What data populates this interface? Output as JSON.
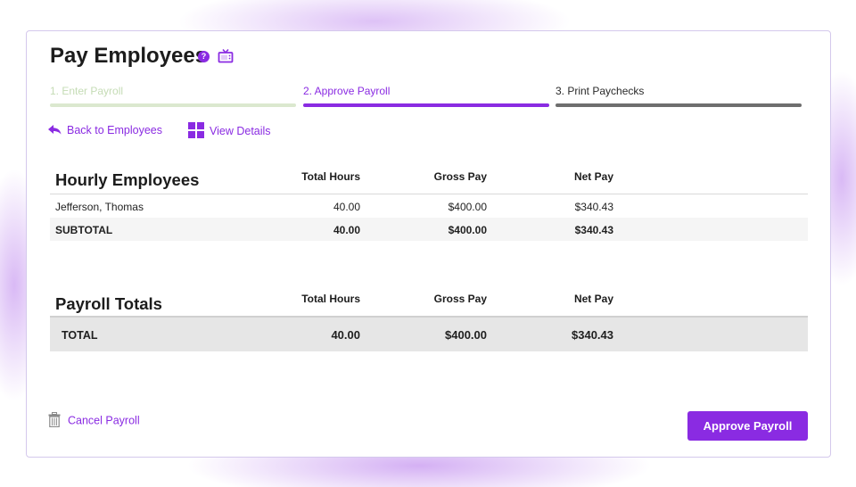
{
  "header": {
    "title": "Pay Employees",
    "help_icon": "question-circle-icon",
    "help_glyph": "?",
    "video_icon": "tv-icon"
  },
  "steps": [
    {
      "label": "1. Enter Payroll",
      "state": "completed",
      "color": "#dbe8cf"
    },
    {
      "label": "2. Approve Payroll",
      "state": "active",
      "color": "#8a2be2"
    },
    {
      "label": "3. Print Paychecks",
      "state": "pending",
      "color": "#6e6e6e"
    }
  ],
  "links": {
    "back": "Back to Employees",
    "back_icon": "reply-arrow-icon",
    "details": "View Details",
    "details_icon": "grid-icon"
  },
  "hourly": {
    "title": "Hourly Employees",
    "columns": [
      "Total Hours",
      "Gross Pay",
      "Net Pay"
    ],
    "rows": [
      {
        "name": "Jefferson, Thomas",
        "hours": "40.00",
        "gross": "$400.00",
        "net": "$340.43"
      }
    ],
    "subtotal": {
      "label": "SUBTOTAL",
      "hours": "40.00",
      "gross": "$400.00",
      "net": "$340.43"
    }
  },
  "totals": {
    "title": "Payroll Totals",
    "columns": [
      "Total Hours",
      "Gross Pay",
      "Net Pay"
    ],
    "total": {
      "label": "TOTAL",
      "hours": "40.00",
      "gross": "$400.00",
      "net": "$340.43"
    }
  },
  "actions": {
    "cancel": "Cancel Payroll",
    "cancel_icon": "trash-icon",
    "approve": "Approve Payroll"
  },
  "colors": {
    "accent": "#8a2be2",
    "step_complete": "#dbe8cf",
    "step_pending": "#6e6e6e"
  }
}
